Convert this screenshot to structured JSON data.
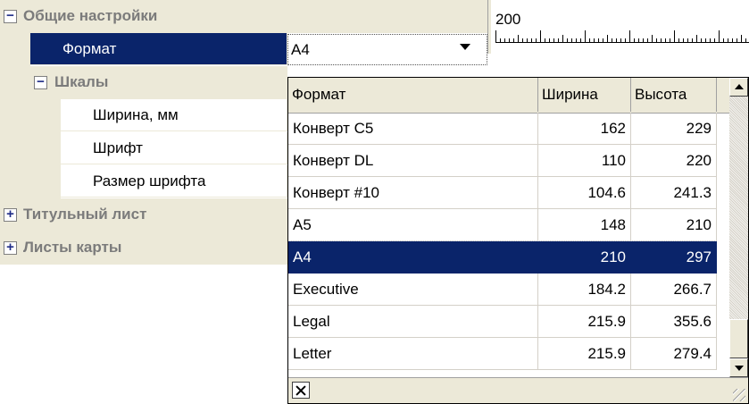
{
  "property_grid": {
    "general": {
      "label": "Общие настройки",
      "toggle": "−"
    },
    "format": {
      "label": "Формат",
      "value": "A4"
    },
    "scales": {
      "label": "Шкалы",
      "toggle": "−"
    },
    "scales_items": [
      {
        "label": "Ширина, мм"
      },
      {
        "label": "Шрифт"
      },
      {
        "label": "Размер шрифта"
      }
    ],
    "title_sheet": {
      "label": "Титульный лист",
      "toggle": "+"
    },
    "map_sheets": {
      "label": "Листы карты",
      "toggle": "+"
    }
  },
  "ruler": {
    "label": "200"
  },
  "format_list": {
    "columns": [
      "Формат",
      "Ширина",
      "Высота"
    ],
    "rows": [
      {
        "name": "Конверт C5",
        "width": "162",
        "height": "229"
      },
      {
        "name": "Конверт DL",
        "width": "110",
        "height": "220"
      },
      {
        "name": "Конверт #10",
        "width": "104.6",
        "height": "241.3"
      },
      {
        "name": "A5",
        "width": "148",
        "height": "210"
      },
      {
        "name": "A4",
        "width": "210",
        "height": "297"
      },
      {
        "name": "Executive",
        "width": "184.2",
        "height": "266.7"
      },
      {
        "name": "Legal",
        "width": "215.9",
        "height": "355.6"
      },
      {
        "name": "Letter",
        "width": "215.9",
        "height": "279.4"
      }
    ],
    "selected_index": 4
  },
  "colors": {
    "selection": "#0a246a",
    "panel": "#ece9d8",
    "category_text": "#7b7b7b"
  }
}
